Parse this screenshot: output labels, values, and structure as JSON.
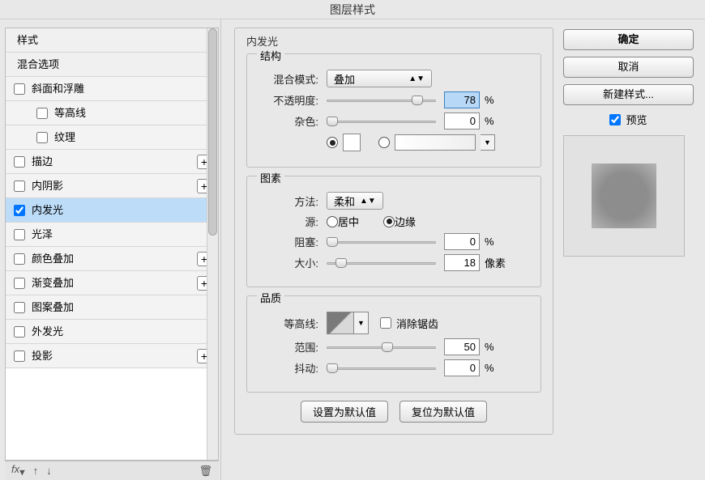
{
  "title": "图层样式",
  "left": {
    "styles_header": "样式",
    "blend_header": "混合选项",
    "items": [
      {
        "label": "斜面和浮雕",
        "checked": false,
        "plus": false
      },
      {
        "label": "等高线",
        "checked": false,
        "plus": false,
        "sub": true
      },
      {
        "label": "纹理",
        "checked": false,
        "plus": false,
        "sub": true
      },
      {
        "label": "描边",
        "checked": false,
        "plus": true
      },
      {
        "label": "内阴影",
        "checked": false,
        "plus": true
      },
      {
        "label": "内发光",
        "checked": true,
        "plus": false,
        "selected": true
      },
      {
        "label": "光泽",
        "checked": false,
        "plus": false
      },
      {
        "label": "颜色叠加",
        "checked": false,
        "plus": true
      },
      {
        "label": "渐变叠加",
        "checked": false,
        "plus": true
      },
      {
        "label": "图案叠加",
        "checked": false,
        "plus": false
      },
      {
        "label": "外发光",
        "checked": false,
        "plus": false
      },
      {
        "label": "投影",
        "checked": false,
        "plus": true
      }
    ],
    "fx_label": "fx"
  },
  "center": {
    "section": "内发光",
    "structure": "结构",
    "blend_mode_lbl": "混合模式:",
    "blend_mode_val": "叠加",
    "opacity_lbl": "不透明度:",
    "opacity_val": "78",
    "pct": "%",
    "noise_lbl": "杂色:",
    "noise_val": "0",
    "elements": "图素",
    "method_lbl": "方法:",
    "method_val": "柔和",
    "source_lbl": "源:",
    "source_center": "居中",
    "source_edge": "边缘",
    "choke_lbl": "阻塞:",
    "choke_val": "0",
    "size_lbl": "大小:",
    "size_val": "18",
    "px": "像素",
    "quality": "品质",
    "contour_lbl": "等高线:",
    "antialias": "消除锯齿",
    "range_lbl": "范围:",
    "range_val": "50",
    "jitter_lbl": "抖动:",
    "jitter_val": "0",
    "default_set": "设置为默认值",
    "default_reset": "复位为默认值"
  },
  "right": {
    "ok": "确定",
    "cancel": "取消",
    "new_style": "新建样式...",
    "preview": "预览"
  }
}
